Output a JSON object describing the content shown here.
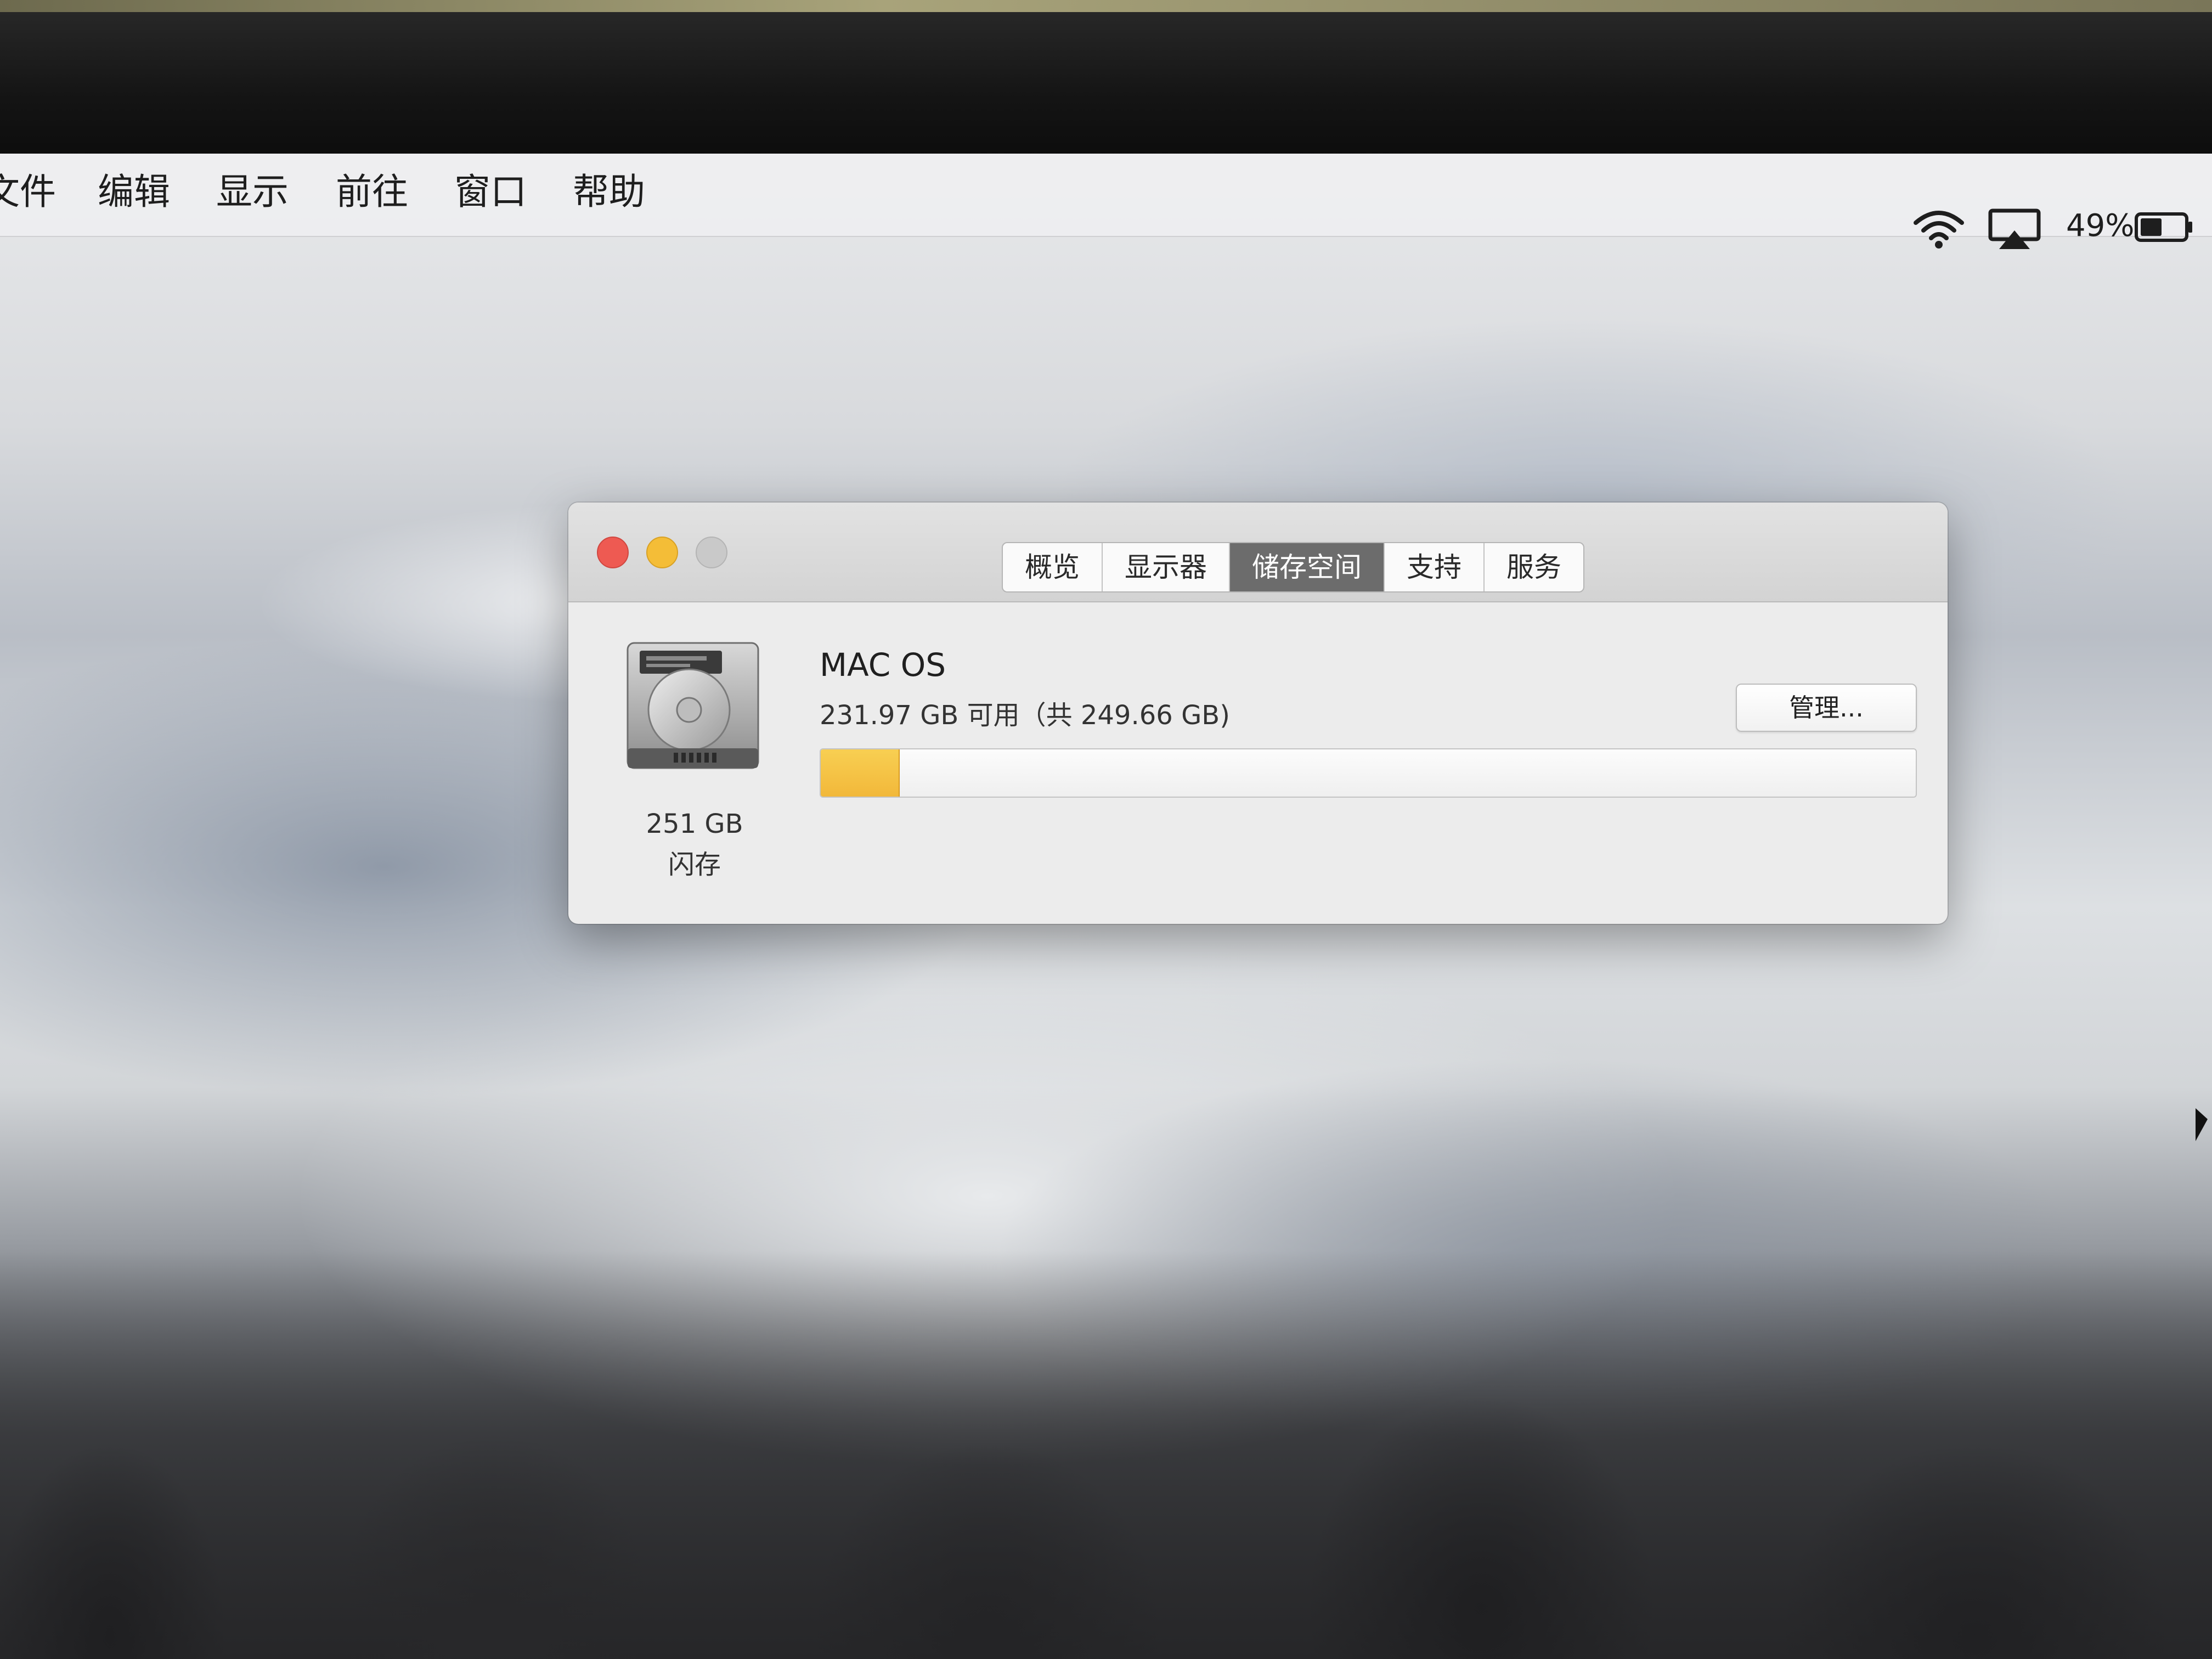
{
  "menubar": {
    "items": [
      "文件",
      "编辑",
      "显示",
      "前往",
      "窗口",
      "帮助"
    ],
    "battery": "49%"
  },
  "window": {
    "tabs": [
      "概览",
      "显示器",
      "储存空间",
      "支持",
      "服务"
    ],
    "active_tab": "储存空间",
    "disk": {
      "size_label": "251 GB",
      "type_label": "闪存"
    },
    "volume": {
      "name": "MAC OS",
      "info": "231.97 GB 可用（共 249.66 GB)",
      "used_fraction": 0.071
    },
    "manage_label": "管理..."
  },
  "colors": {
    "used_bar": "#f2b83a",
    "close": "#ee5a52",
    "minimize": "#f4bd37",
    "zoom": "#c9c9c9",
    "active_tab": "#6c6c6c"
  },
  "icons": [
    "wifi-icon",
    "airplay-icon",
    "battery-icon",
    "hard-drive-icon",
    "mouse-cursor-icon"
  ]
}
